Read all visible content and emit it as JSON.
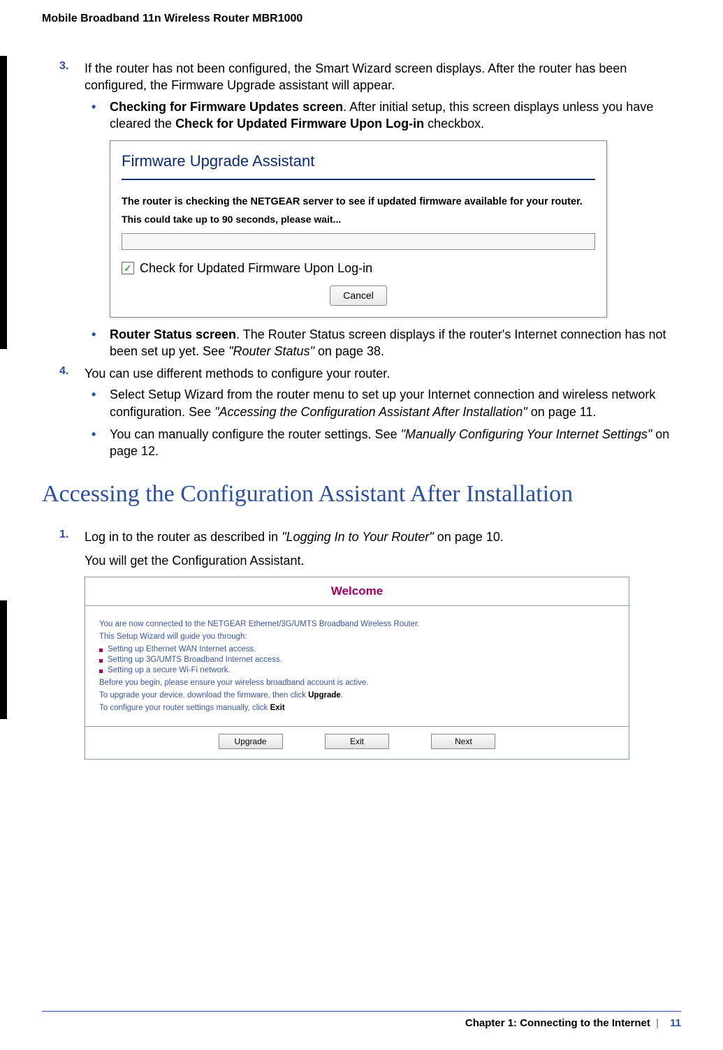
{
  "doc_title": "Mobile Broadband 11n Wireless Router MBR1000",
  "step3": {
    "num": "3.",
    "text": "If the router has not been configured, the Smart Wizard screen displays. After the router has been configured, the Firmware Upgrade assistant will appear.",
    "bullets": [
      {
        "bold_lead": "Checking for Firmware Updates screen",
        "after_lead": ". After initial setup, this screen displays unless you have cleared the ",
        "bold_inner": "Check for Updated Firmware Upon Log-in",
        "tail": " checkbox."
      },
      {
        "bold_lead": "Router Status screen",
        "after_lead": ". The Router Status screen displays if the router's Internet connection has not been set up yet. See ",
        "italic": "\"Router Status\"",
        "tail": " on page 38."
      }
    ]
  },
  "firmware": {
    "title": "Firmware Upgrade Assistant",
    "msg1": "The router is checking the NETGEAR server to see if updated firmware available for your router.",
    "msg2": "This could take up to 90 seconds, please wait...",
    "checkbox_label": "Check for Updated Firmware Upon Log-in",
    "cancel": "Cancel"
  },
  "step4": {
    "num": "4.",
    "text": "You can use different methods to configure your router.",
    "bullets": [
      {
        "pre": "Select Setup Wizard from the router menu to set up your Internet connection and wireless network configuration. See ",
        "italic": "\"Accessing the Configuration Assistant After Installation\"",
        "post": " on page 11."
      },
      {
        "pre": "You can manually configure the router settings. See ",
        "italic": "\"Manually Configuring Your Internet Settings\"",
        "post": " on page 12."
      }
    ]
  },
  "heading": "Accessing the Configuration Assistant After Installation",
  "sectB_step1": {
    "num": "1.",
    "pre": "Log in to the router as described in ",
    "italic": "\"Logging In to Your Router\"",
    "post": " on page 10.",
    "line2": "You will get the Configuration Assistant."
  },
  "welcome": {
    "title": "Welcome",
    "p1": "You are now connected to the NETGEAR Ethernet/3G/UMTS Broadband Wireless Router.",
    "p2": "This Setup Wizard will guide you through:",
    "items": [
      "Setting up Ethernet WAN Internet access.",
      "Setting up 3G/UMTS Broadband Internet access.",
      "Setting up a secure Wi-Fi network."
    ],
    "p3": "Before you begin, please ensure your wireless broadband account is active.",
    "p4_pre": "To upgrade your device, download the firmware, then click ",
    "p4_bold": "Upgrade",
    "p4_post": ".",
    "p5_pre": "To configure your router settings manually, click ",
    "p5_bold": "Exit",
    "buttons": {
      "upgrade": "Upgrade",
      "exit": "Exit",
      "next": "Next"
    }
  },
  "footer": {
    "chapter": "Chapter 1:  Connecting to the Internet",
    "sep": "|",
    "page": "11"
  }
}
